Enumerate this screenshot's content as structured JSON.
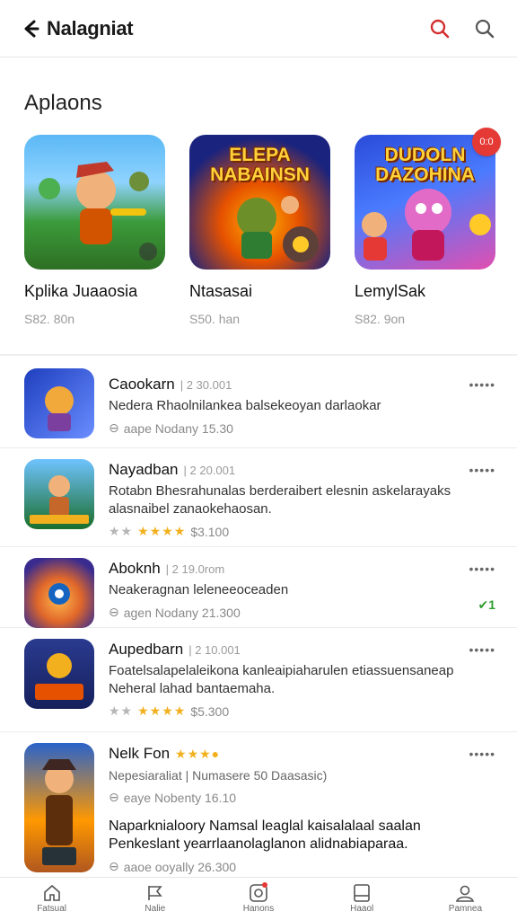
{
  "header": {
    "title": "Nalagniat",
    "back_icon": "back-arrow-icon",
    "actions": [
      {
        "icon": "search-icon",
        "color": "#d32f2f"
      },
      {
        "icon": "search-icon",
        "color": "#555555"
      }
    ]
  },
  "featured": {
    "section_title": "Aplaons",
    "items": [
      {
        "name": "Kplika Juaaosia",
        "meta": "S82. 80n",
        "art_text": "",
        "colors": [
          "#3fa9f5",
          "#2e7d32"
        ]
      },
      {
        "name": "Ntasasai",
        "meta": "S50. han",
        "art_text": "ELEPA NABAINSN",
        "colors": [
          "#1e3c8a",
          "#f57c00"
        ]
      },
      {
        "name": "LemylSak",
        "meta": "S82. 9on",
        "art_text": "DUDOLN DAZOHINA",
        "colors": [
          "#2a4bd8",
          "#e24fb0"
        ],
        "badge": "0:0"
      }
    ]
  },
  "list": [
    {
      "name": "Caookarn",
      "date": "2 30.001",
      "desc": [
        "Nedera Rhaolnilankea balsekeoyan darlaokar"
      ],
      "meta_icon": "age-icon",
      "meta": "aape Nodany 15.30",
      "rating": null,
      "more": "•••••",
      "colors": [
        "#1f3fbf",
        "#f2a93b"
      ]
    },
    {
      "name": "Nayadban",
      "date": "2 20.001",
      "desc": [
        "Rotabn Bhesrahunalas berderaibert elesnin askelarayaks",
        "alasnaibel zanaokehaosan."
      ],
      "meta_icon": "",
      "meta": "$3.100",
      "rating": {
        "grey": "★★",
        "gold": "★★★★"
      },
      "more": "•••••",
      "colors": [
        "#1a6e2a",
        "#c5662a"
      ]
    },
    {
      "name": "Aboknh",
      "date": "2 19.0rom",
      "desc": [
        "Neakeragnan leleneeoceaden"
      ],
      "meta_icon": "age-icon",
      "meta": "agen Nodany 21.300",
      "rating": null,
      "more": "•••••",
      "side_mark": "✔1",
      "colors": [
        "#3a2c8f",
        "#e0672a"
      ]
    },
    {
      "name": "Aupedbarn",
      "date": "2 10.001",
      "desc": [
        "Foatelsalapelaleikona kanleaipiaharulen etiassuensaneap",
        "Neheral lahad bantaemaha."
      ],
      "meta_icon": "",
      "meta": "$5.300",
      "rating": {
        "grey": "★★",
        "gold": "★★★★"
      },
      "more": "•••••",
      "colors": [
        "#15205c",
        "#f2b01e"
      ]
    },
    {
      "name": "Nelk Fon",
      "name_stars": "★★★●",
      "date": "",
      "desc": [
        "Nepesiaraliat | Numasere 50 Daasasic)"
      ],
      "meta_icon": "age-icon",
      "meta": "eaye Nobenty 16.10",
      "desc2": [
        "Naparknialoory Namsal leaglal kaisalalaal saalan",
        "Penkeslant yearrlaanolaglanon alidnabiaparaa."
      ],
      "meta2": "aaoe ooyally 26.300",
      "rating": null,
      "more": "•••••",
      "colors": [
        "#2a63c9",
        "#b0571f"
      ]
    }
  ],
  "bottom_nav": [
    {
      "icon": "home-icon",
      "label": "Fatsual"
    },
    {
      "icon": "flag-icon",
      "label": "Nalie"
    },
    {
      "icon": "apps-icon",
      "label": "Hanons",
      "dot": true
    },
    {
      "icon": "library-icon",
      "label": "Haaol"
    },
    {
      "icon": "profile-icon",
      "label": "Pamnea"
    }
  ]
}
